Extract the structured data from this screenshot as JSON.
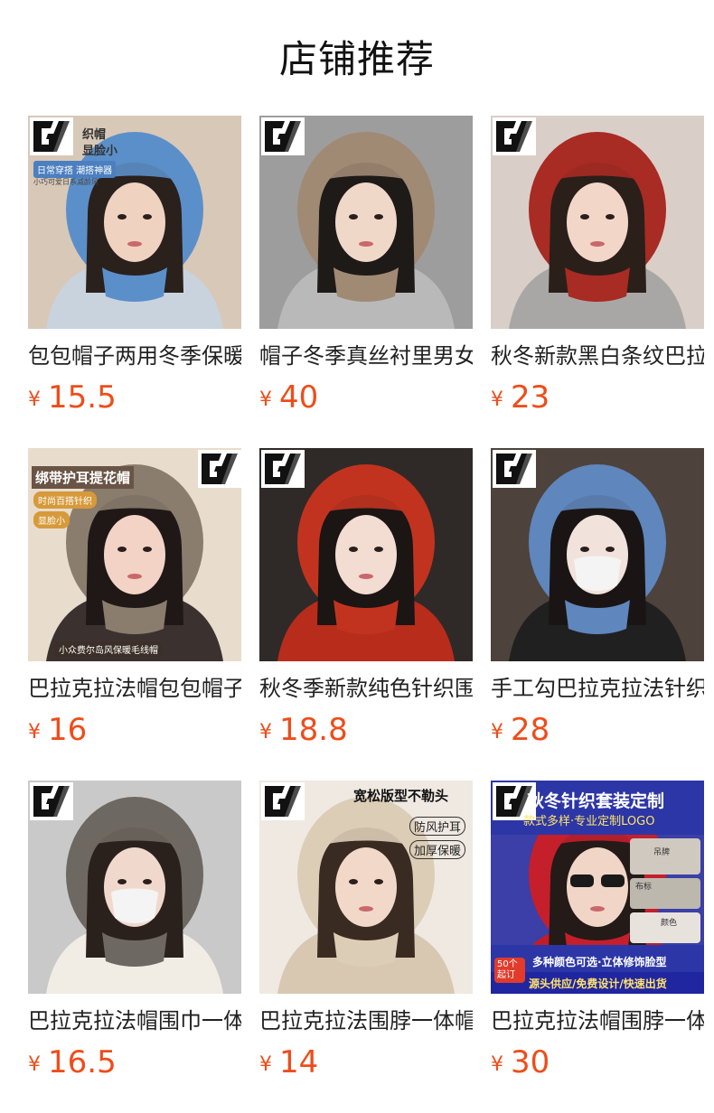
{
  "page": {
    "title": "店铺推荐"
  },
  "products": [
    {
      "name": "包包帽子两用冬季保暖",
      "currency": "¥",
      "price": "15.5",
      "image_texts": [
        "织帽",
        "显脸小",
        "日常穿搭 潮搭神器",
        "小巧可爱日系减龄风"
      ],
      "colors": {
        "bg": "#d8c8b8",
        "hat": "#5b8fc9",
        "coat": "#c9d3de",
        "skin": "#efd2c0",
        "hair": "#2a201c"
      }
    },
    {
      "name": "帽子冬季真丝衬里男女",
      "currency": "¥",
      "price": "40",
      "image_texts": [],
      "colors": {
        "bg": "#9d9d9d",
        "hat": "#a08a74",
        "coat": "#b9b9b9",
        "skin": "#f0d8c8",
        "hair": "#1e1a18"
      }
    },
    {
      "name": "秋冬新款黑白条纹巴拉",
      "currency": "¥",
      "price": "23",
      "image_texts": [],
      "colors": {
        "bg": "#d9cfc8",
        "hat": "#a82b24",
        "coat": "#a9a7a6",
        "skin": "#f2d7c9",
        "hair": "#2b1f1a"
      }
    },
    {
      "name": "巴拉克拉法帽包包帽子",
      "currency": "¥",
      "price": "16",
      "image_texts": [
        "绑带护耳提花帽",
        "时尚百搭针织",
        "显脸小",
        "小众费尔岛风保暖毛线帽"
      ],
      "colors": {
        "bg": "#e8dccd",
        "hat": "#8a7d6e",
        "coat": "#3b3230",
        "skin": "#f3d3c6",
        "hair": "#1f1816"
      }
    },
    {
      "name": "秋冬季新款纯色针织围",
      "currency": "¥",
      "price": "18.8",
      "image_texts": [],
      "colors": {
        "bg": "#2f2a28",
        "hat": "#c2331f",
        "coat": "#b82c1c",
        "skin": "#f3dcd2",
        "hair": "#1b1514"
      }
    },
    {
      "name": "手工勾巴拉克拉法针织",
      "currency": "¥",
      "price": "28",
      "image_texts": [],
      "colors": {
        "bg": "#4d433c",
        "hat": "#5f86bd",
        "coat": "#202020",
        "skin": "#f1e2db",
        "hair": "#1a1514"
      }
    },
    {
      "name": "巴拉克拉法帽围巾一体",
      "currency": "¥",
      "price": "16.5",
      "image_texts": [],
      "colors": {
        "bg": "#c9c9c9",
        "hat": "#6e6862",
        "coat": "#f1ede4",
        "skin": "#f0d9cc",
        "hair": "#2a211d"
      }
    },
    {
      "name": "巴拉克拉法围脖一体帽",
      "currency": "¥",
      "price": "14",
      "image_texts": [
        "宽松版型不勒头",
        "防风护耳",
        "加厚保暖"
      ],
      "colors": {
        "bg": "#efe9e2",
        "hat": "#dccdb7",
        "coat": "#d8c8b2",
        "skin": "#f2d8c9",
        "hair": "#3a2b22"
      }
    },
    {
      "name": "巴拉克拉法帽围脖一体",
      "currency": "¥",
      "price": "30",
      "image_texts": [
        "秋冬针织套装定制",
        "款式多样·专业定制LOGO",
        "多种颜色可选·立体修饰脸型",
        "源头供应/免费设计/快速出货",
        "50个起订",
        "吊牌",
        "布标",
        "颜色"
      ],
      "colors": {
        "bg": "#3b3fa7",
        "hat": "#c41f2b",
        "coat": "#c01d29",
        "skin": "#f1d6c8",
        "hair": "#241a18"
      }
    }
  ]
}
